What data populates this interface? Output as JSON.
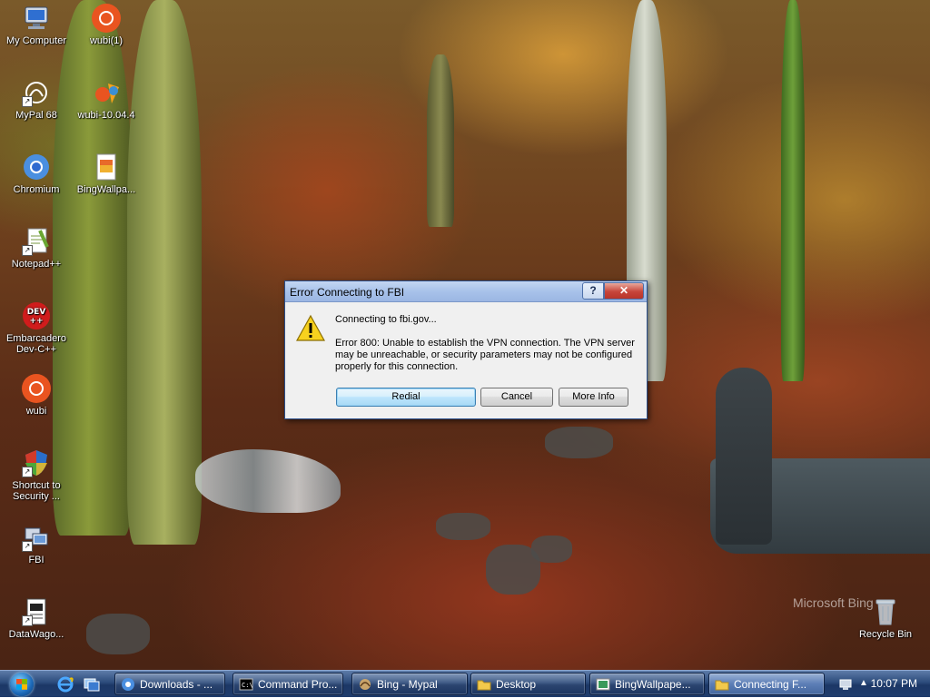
{
  "desktop": {
    "icons": [
      {
        "label": "My Computer",
        "icon": "computer-icon"
      },
      {
        "label": "wubi(1)",
        "icon": "ubuntu-icon"
      },
      {
        "label": "MyPal 68",
        "icon": "mypal-icon"
      },
      {
        "label": "wubi-10.04.4",
        "icon": "ubuntu-installer-icon"
      },
      {
        "label": "Chromium",
        "icon": "chromium-icon"
      },
      {
        "label": "BingWallpa...",
        "icon": "bing-wallpaper-icon"
      },
      {
        "label": "Notepad++",
        "icon": "notepad-plus-plus-icon"
      },
      {
        "label": "Embarcadero Dev-C++",
        "icon": "devcpp-icon"
      },
      {
        "label": "wubi",
        "icon": "ubuntu-icon"
      },
      {
        "label": "Shortcut to Security ...",
        "icon": "security-shield-icon"
      },
      {
        "label": "FBI",
        "icon": "network-connection-icon"
      },
      {
        "label": "DataWago...",
        "icon": "document-icon"
      },
      {
        "label": "Recycle Bin",
        "icon": "recycle-bin-icon"
      }
    ],
    "watermark": "Microsoft Bing"
  },
  "dialog": {
    "title": "Error Connecting to FBI",
    "help_label": "?",
    "close_label": "✕",
    "message_heading": "Connecting to fbi.gov...",
    "message_body": "Error 800: Unable to establish the VPN connection.  The VPN server may be unreachable, or security parameters may not be configured properly for this connection.",
    "buttons": {
      "redial": "Redial",
      "cancel": "Cancel",
      "more_info": "More Info"
    },
    "icon": "warning-icon"
  },
  "taskbar": {
    "tasks": [
      {
        "label": "Downloads - ...",
        "icon": "chromium-icon"
      },
      {
        "label": "Command Pro...",
        "icon": "command-prompt-icon"
      },
      {
        "label": "Bing - Mypal",
        "icon": "mypal-icon"
      },
      {
        "label": "Desktop",
        "icon": "folder-icon"
      },
      {
        "label": "BingWallpape...",
        "icon": "image-icon"
      },
      {
        "label": "Connecting F...",
        "icon": "folder-icon"
      }
    ],
    "clock": "10:07 PM",
    "colors": {
      "accent": "#1c3766",
      "active": "#5c7eb6"
    }
  }
}
